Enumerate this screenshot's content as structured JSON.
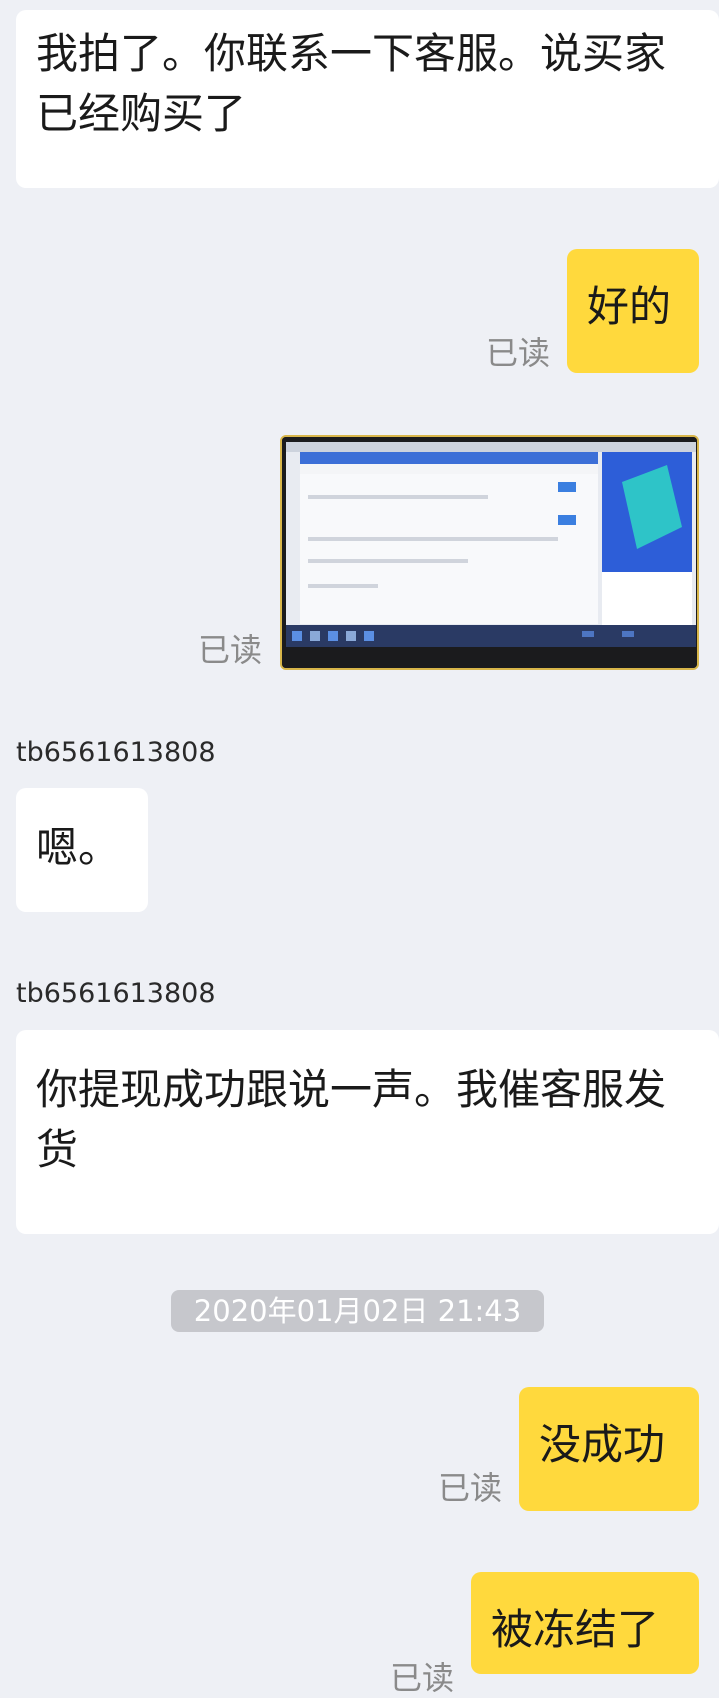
{
  "messages": {
    "m1": {
      "text": "我拍了。你联系一下客服。说买家已经购买了"
    },
    "m2": {
      "text": "好的",
      "status": "已读"
    },
    "m3": {
      "status": "已读",
      "image_description_icon": "screenshot-image"
    },
    "m4": {
      "sender": "tb6561613808",
      "text": "嗯。"
    },
    "m5": {
      "sender": "tb6561613808",
      "text": "你提现成功跟说一声。我催客服发货"
    },
    "divider": {
      "time": "2020年01月02日 21:43"
    },
    "m6": {
      "text": "没成功",
      "status": "已读"
    },
    "m7": {
      "text": "被冻结了",
      "status": "已读"
    }
  },
  "colors": {
    "background": "#eef0f5",
    "incoming_bubble": "#ffffff",
    "outgoing_bubble": "#ffd93d",
    "read_text": "#8a8a8a",
    "timestamp_bg": "#c6c7cc"
  }
}
